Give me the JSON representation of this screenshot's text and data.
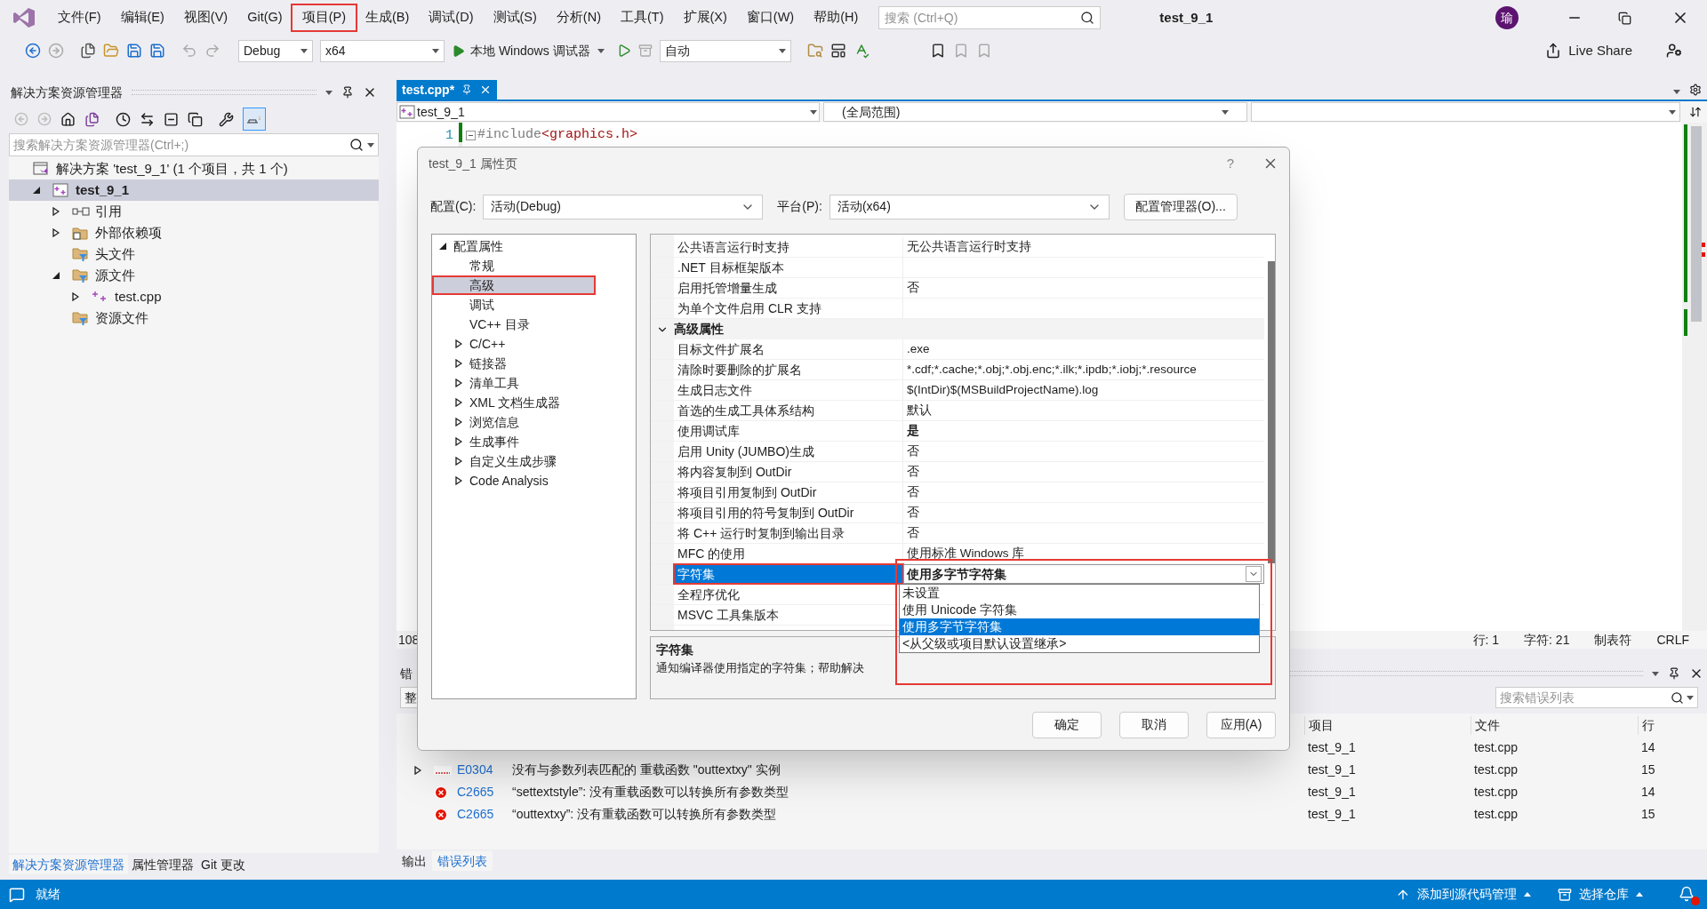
{
  "window": {
    "title": "test_9_1",
    "avatar": "瑜",
    "search_placeholder": "搜索 (Ctrl+Q)"
  },
  "menu": [
    {
      "label": "文件(F)",
      "highlighted": false
    },
    {
      "label": "编辑(E)",
      "highlighted": false
    },
    {
      "label": "视图(V)",
      "highlighted": false
    },
    {
      "label": "Git(G)",
      "highlighted": false
    },
    {
      "label": "项目(P)",
      "highlighted": true
    },
    {
      "label": "生成(B)",
      "highlighted": false
    },
    {
      "label": "调试(D)",
      "highlighted": false
    },
    {
      "label": "测试(S)",
      "highlighted": false
    },
    {
      "label": "分析(N)",
      "highlighted": false
    },
    {
      "label": "工具(T)",
      "highlighted": false
    },
    {
      "label": "扩展(X)",
      "highlighted": false
    },
    {
      "label": "窗口(W)",
      "highlighted": false
    },
    {
      "label": "帮助(H)",
      "highlighted": false
    }
  ],
  "toolbar": {
    "configuration": "Debug",
    "platform": "x64",
    "debugger": "本地 Windows 调试器",
    "mode": "自动",
    "live_share": "Live Share"
  },
  "solution_explorer": {
    "title": "解决方案资源管理器",
    "search_placeholder": "搜索解决方案资源管理器(Ctrl+;)",
    "tree": [
      {
        "label": "解决方案 'test_9_1' (1 个项目，共 1 个)",
        "kind": "solution",
        "selected": false,
        "children": [
          {
            "label": "test_9_1",
            "kind": "project",
            "selected": true,
            "expanded": true,
            "children": [
              {
                "label": "引用",
                "kind": "references",
                "selected": false,
                "expanded": false
              },
              {
                "label": "外部依赖项",
                "kind": "external",
                "selected": false,
                "expanded": false
              },
              {
                "label": "头文件",
                "kind": "filter",
                "selected": false
              },
              {
                "label": "源文件",
                "kind": "filter",
                "selected": false,
                "expanded": true,
                "children": [
                  {
                    "label": "test.cpp",
                    "kind": "cpp",
                    "selected": false,
                    "expanded": false
                  }
                ]
              },
              {
                "label": "资源文件",
                "kind": "filter",
                "selected": false
              }
            ]
          }
        ]
      }
    ]
  },
  "left_tabs": [
    {
      "label": "解决方案资源管理器",
      "selected": true
    },
    {
      "label": "属性管理器",
      "selected": false
    },
    {
      "label": "Git 更改",
      "selected": false
    }
  ],
  "editor": {
    "tab": "test.cpp*",
    "scope": "test_9_1",
    "context": "(全局范围)",
    "lines": [
      {
        "number": "1",
        "directive": "#include",
        "path": "<graphics.h>"
      }
    ],
    "zoom": "108",
    "status": [
      "行: 1",
      "字符: 21",
      "制表符",
      "CRLF"
    ]
  },
  "error_list": {
    "title": "错",
    "scope": "整",
    "search_placeholder": "搜索错误列表",
    "columns": [
      "项目",
      "文件",
      "行"
    ],
    "rows": [
      {
        "project": "test_9_1",
        "file": "test.cpp",
        "line": "14"
      },
      {
        "kind": "intellisense",
        "expanded": false,
        "code": "E0304",
        "message": "没有与参数列表匹配的 重载函数 \"outtextxy\" 实例",
        "project": "test_9_1",
        "file": "test.cpp",
        "line": "15"
      },
      {
        "kind": "error",
        "code": "C2665",
        "message": "“settextstyle”: 没有重载函数可以转换所有参数类型",
        "project": "test_9_1",
        "file": "test.cpp",
        "line": "14"
      },
      {
        "kind": "error",
        "code": "C2665",
        "message": "“outtextxy”: 没有重载函数可以转换所有参数类型",
        "project": "test_9_1",
        "file": "test.cpp",
        "line": "15"
      }
    ]
  },
  "right_tabs": [
    {
      "label": "输出",
      "selected": false
    },
    {
      "label": "错误列表",
      "selected": true
    }
  ],
  "status_bar": {
    "text": "就绪",
    "source_control": "添加到源代码管理",
    "repository": "选择仓库"
  },
  "dialog": {
    "title": "test_9_1 属性页",
    "help": "?",
    "configuration_label": "配置(C):",
    "configuration": "活动(Debug)",
    "platform_label": "平台(P):",
    "platform": "活动(x64)",
    "manager_button": "配置管理器(O)...",
    "tree": [
      {
        "label": "配置属性",
        "selected": false,
        "expanded": true,
        "children": [
          {
            "label": "常规",
            "selected": false
          },
          {
            "label": "高级",
            "selected": true,
            "highlighted": true
          },
          {
            "label": "调试",
            "selected": false
          },
          {
            "label": "VC++ 目录",
            "selected": false
          },
          {
            "label": "C/C++",
            "selected": false,
            "expanded": false
          },
          {
            "label": "链接器",
            "selected": false,
            "expanded": false
          },
          {
            "label": "清单工具",
            "selected": false,
            "expanded": false
          },
          {
            "label": "XML 文档生成器",
            "selected": false,
            "expanded": false
          },
          {
            "label": "浏览信息",
            "selected": false,
            "expanded": false
          },
          {
            "label": "生成事件",
            "selected": false,
            "expanded": false
          },
          {
            "label": "自定义生成步骤",
            "selected": false,
            "expanded": false
          },
          {
            "label": "Code Analysis",
            "selected": false,
            "expanded": false
          }
        ]
      }
    ],
    "properties": [
      {
        "kind": "property",
        "name": "公共语言运行时支持",
        "value": "无公共语言运行时支持"
      },
      {
        "kind": "property",
        "name": ".NET 目标框架版本"
      },
      {
        "kind": "property",
        "name": "启用托管增量生成",
        "value": "否"
      },
      {
        "kind": "property",
        "name": "为单个文件启用 CLR 支持"
      },
      {
        "kind": "group",
        "name": "高级属性",
        "expanded": true
      },
      {
        "kind": "property",
        "name": "目标文件扩展名",
        "value": ".exe"
      },
      {
        "kind": "property",
        "name": "清除时要删除的扩展名",
        "value": "*.cdf;*.cache;*.obj;*.obj.enc;*.ilk;*.ipdb;*.iobj;*.resource"
      },
      {
        "kind": "property",
        "name": "生成日志文件",
        "value": "$(IntDir)$(MSBuildProjectName).log"
      },
      {
        "kind": "property",
        "name": "首选的生成工具体系结构",
        "value": "默认"
      },
      {
        "kind": "property",
        "name": "使用调试库",
        "value": "是",
        "bold": true
      },
      {
        "kind": "property",
        "name": "启用 Unity (JUMBO)生成",
        "value": "否"
      },
      {
        "kind": "property",
        "name": "将内容复制到 OutDir",
        "value": "否"
      },
      {
        "kind": "property",
        "name": "将项目引用复制到 OutDir",
        "value": "否"
      },
      {
        "kind": "property",
        "name": "将项目引用的符号复制到 OutDir",
        "value": "否"
      },
      {
        "kind": "property",
        "name": "将 C++ 运行时复制到输出目录",
        "value": "否"
      },
      {
        "kind": "property",
        "name": "MFC 的使用",
        "value": "使用标准 Windows 库"
      },
      {
        "kind": "dropdown",
        "name": "字符集",
        "value": "使用多字节字符集",
        "selected": true,
        "highlighted": true,
        "bold": true
      },
      {
        "kind": "property",
        "name": "全程序优化"
      },
      {
        "kind": "property",
        "name": "MSVC 工具集版本"
      }
    ],
    "description": {
      "title": "字符集",
      "text": "通知编译器使用指定的字符集；帮助解决"
    },
    "dropdown": {
      "highlighted": true,
      "options": [
        {
          "label": "未设置",
          "selected": false
        },
        {
          "label": "使用 Unicode 字符集",
          "selected": false
        },
        {
          "label": "使用多字节字符集",
          "selected": true
        },
        {
          "label": "<从父级或项目默认设置继承>",
          "selected": false
        }
      ]
    },
    "buttons": [
      "确定",
      "取消",
      "应用(A)"
    ]
  }
}
